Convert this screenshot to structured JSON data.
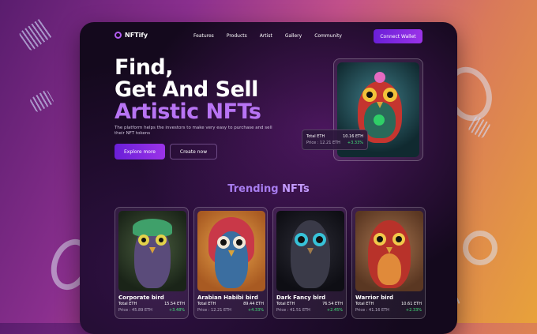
{
  "brand": {
    "name": "NFTify"
  },
  "nav": {
    "links": [
      "Features",
      "Products",
      "Artist",
      "Gallery",
      "Community"
    ],
    "connect_label": "Connect Wallet"
  },
  "hero": {
    "title_line1": "Find,",
    "title_line2": "Get And Sell",
    "title_accent": "Artistic NFTs",
    "description": "The platform helps the investors to make very easy to purchase and sell their NFT tokens",
    "explore_label": "Explore more",
    "create_label": "Create now",
    "stat": {
      "label": "Total ETH",
      "value": "10.16 ETH",
      "price": "Price : 12.21 ETH",
      "change": "+3.33%"
    }
  },
  "trending": {
    "title_main": "Trending",
    "title_accent": "NFTs",
    "cards": [
      {
        "name": "Corporate bird",
        "total_label": "Total ETH",
        "total": "15.54 ETH",
        "price": "Price : 45.89 ETH",
        "change": "+3.48%",
        "bg": "#2a3b2c",
        "owl": "#5a4b7a",
        "accent": "#3fa06a"
      },
      {
        "name": "Arabian Habibi bird",
        "total_label": "Total ETH",
        "total": "89.44 ETH",
        "price": "Price : 12.21 ETH",
        "change": "+4.33%",
        "bg": "#c8782e",
        "owl": "#3b6ea0",
        "accent": "#c93848"
      },
      {
        "name": "Dark Fancy bird",
        "total_label": "Total ETH",
        "total": "76.54 ETH",
        "price": "Price : 41.51 ETH",
        "change": "+2.45%",
        "bg": "#1a1a22",
        "owl": "#3a3a48",
        "accent": "#37c2d8"
      },
      {
        "name": "Warrior bird",
        "total_label": "Total ETH",
        "total": "10.61 ETH",
        "price": "Price : 41.16 ETH",
        "change": "+2.33%",
        "bg": "#8a5a3a",
        "owl": "#b8322a",
        "accent": "#e08a3a"
      }
    ]
  },
  "colors": {
    "accent": "#9b33e8",
    "positive": "#42e47a"
  }
}
